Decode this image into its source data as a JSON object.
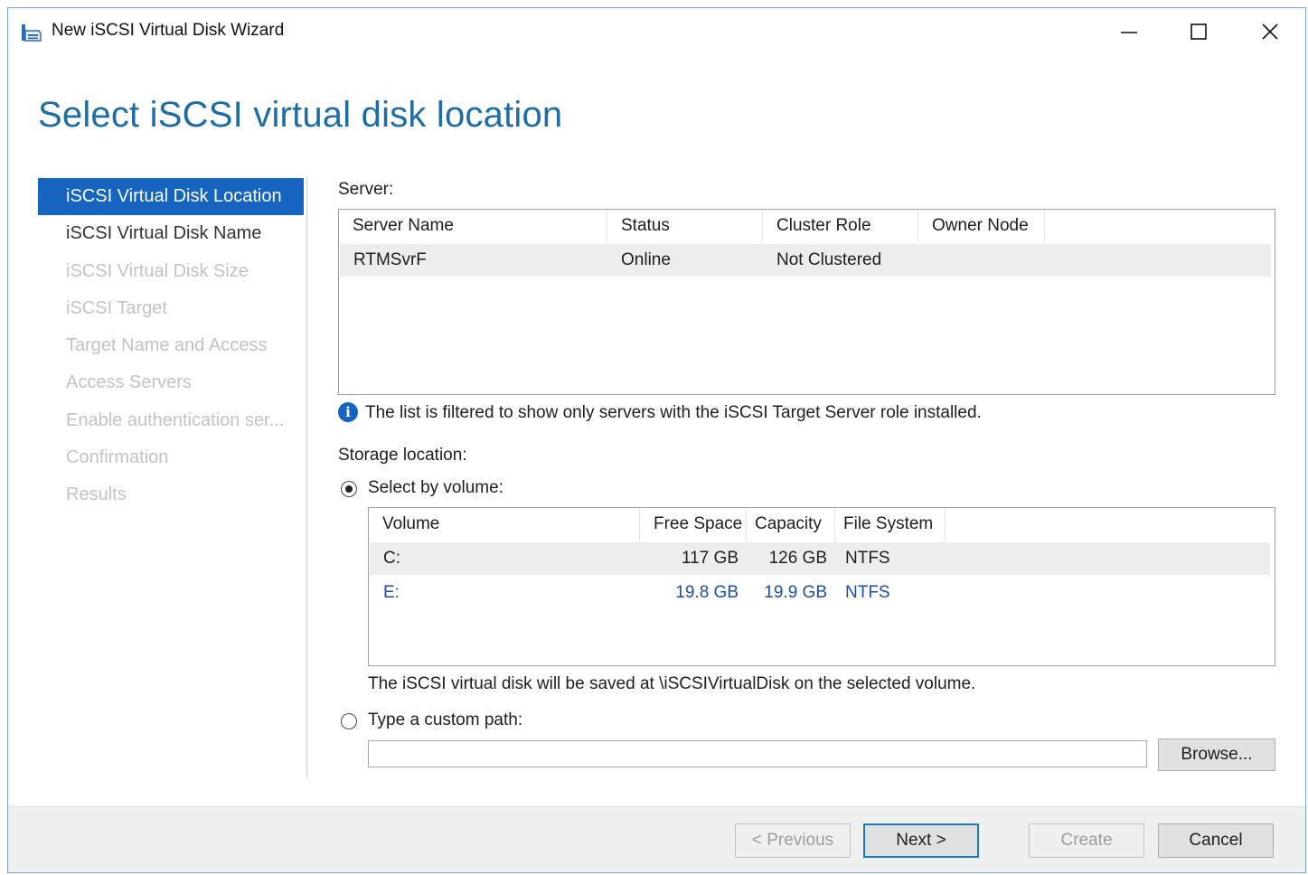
{
  "window": {
    "title": "New iSCSI Virtual Disk Wizard"
  },
  "page": {
    "title": "Select iSCSI virtual disk location"
  },
  "steps": [
    {
      "label": "iSCSI Virtual Disk Location",
      "state": "active"
    },
    {
      "label": "iSCSI Virtual Disk Name",
      "state": "enabled"
    },
    {
      "label": "iSCSI Virtual Disk Size",
      "state": "disabled"
    },
    {
      "label": "iSCSI Target",
      "state": "disabled"
    },
    {
      "label": "Target Name and Access",
      "state": "disabled"
    },
    {
      "label": "Access Servers",
      "state": "disabled"
    },
    {
      "label": "Enable authentication ser...",
      "state": "disabled"
    },
    {
      "label": "Confirmation",
      "state": "disabled"
    },
    {
      "label": "Results",
      "state": "disabled"
    }
  ],
  "server": {
    "label": "Server:",
    "columns": [
      "Server Name",
      "Status",
      "Cluster Role",
      "Owner Node"
    ],
    "rows": [
      {
        "name": "RTMSvrF",
        "status": "Online",
        "cluster_role": "Not Clustered",
        "owner_node": ""
      }
    ]
  },
  "info": {
    "icon": "info-icon",
    "text": "The list is filtered to show only servers with the iSCSI Target Server role installed."
  },
  "storage": {
    "label": "Storage location:",
    "by_volume_label": "Select by volume:",
    "by_volume_selected": true,
    "columns": [
      "Volume",
      "Free Space",
      "Capacity",
      "File System"
    ],
    "rows": [
      {
        "volume": "C:",
        "free": "117 GB",
        "capacity": "126 GB",
        "fs": "NTFS"
      },
      {
        "volume": "E:",
        "free": "19.8 GB",
        "capacity": "19.9 GB",
        "fs": "NTFS"
      }
    ],
    "note": "The iSCSI virtual disk will be saved at \\iSCSIVirtualDisk on the selected volume.",
    "custom_path_label": "Type a custom path:",
    "custom_path_value": "",
    "browse_label": "Browse..."
  },
  "buttons": {
    "previous": "< Previous",
    "next": "Next >",
    "create": "Create",
    "cancel": "Cancel"
  },
  "colors": {
    "accent": "#1565c0",
    "title_blue": "#1f6ea3",
    "value_blue": "#1f4e9c"
  }
}
